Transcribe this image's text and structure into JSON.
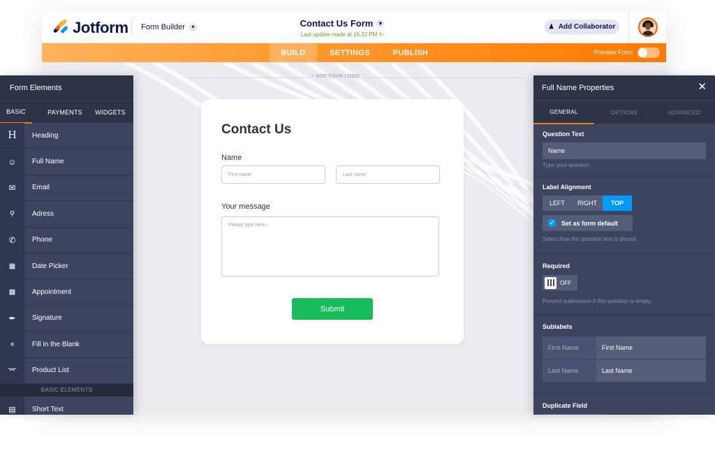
{
  "header": {
    "brand": "Jotform",
    "builder_label": "Form Builder",
    "form_title": "Contact Us Form",
    "last_update": "Last update made at 16:32 PM",
    "add_collaborator": "Add Collaborator"
  },
  "nav": {
    "tabs": [
      {
        "label": "BUILD",
        "active": true
      },
      {
        "label": "SETTINGS",
        "active": false
      },
      {
        "label": "PUBLISH",
        "active": false
      }
    ],
    "preview_label": "Preview Form",
    "preview_on": false
  },
  "canvas": {
    "logo_slot": "+ ADD YOUR LOGO"
  },
  "form": {
    "title": "Contact Us",
    "name_label": "Name",
    "first_placeholder": "First name",
    "last_placeholder": "Last name",
    "message_label": "Your message",
    "message_placeholder": "Please type here...",
    "submit_label": "Submit"
  },
  "left_panel": {
    "title": "Form Elements",
    "tabs": [
      "BASIC",
      "PAYMENTS",
      "WIDGETS"
    ],
    "items": [
      {
        "label": "Heading",
        "icon": "heading-icon"
      },
      {
        "label": "Full Name",
        "icon": "user-icon"
      },
      {
        "label": "Email",
        "icon": "envelope-icon"
      },
      {
        "label": "Adress",
        "icon": "location-pin-icon"
      },
      {
        "label": "Phone",
        "icon": "phone-icon"
      },
      {
        "label": "Date Picker",
        "icon": "calendar-icon"
      },
      {
        "label": "Appointment",
        "icon": "appointment-icon"
      },
      {
        "label": "Signature",
        "icon": "pen-icon"
      },
      {
        "label": "Fill in the Blank",
        "icon": "fill-blank-icon"
      },
      {
        "label": "Product List",
        "icon": "cart-icon"
      }
    ],
    "section_label": "BASIC ELEMENTS",
    "extra_items": [
      {
        "label": "Short Text",
        "icon": "short-text-icon"
      }
    ]
  },
  "right_panel": {
    "title": "Full Name Properties",
    "tabs": [
      "GENERAL",
      "OPTIONS",
      "ADVANCED"
    ],
    "question_text": {
      "title": "Question Text",
      "value": "Name",
      "hint": "Type your question."
    },
    "label_alignment": {
      "title": "Label Alignment",
      "options": [
        "LEFT",
        "RIGHT",
        "TOP"
      ],
      "selected": "TOP",
      "default_label": "Set as form default",
      "hint": "Select how the question text is placed."
    },
    "required": {
      "title": "Required",
      "state": "OFF",
      "hint": "Prevent submission if this question is empty."
    },
    "sublabels": {
      "title": "Sublabels",
      "rows": [
        {
          "key": "First Name",
          "value": "First Name"
        },
        {
          "key": "Last Name",
          "value": "Last Name"
        }
      ]
    },
    "duplicate": {
      "title": "Duplicate Field"
    }
  },
  "colors": {
    "accent_orange": "#ff7a00",
    "submit_green": "#18bd5b",
    "selected_blue": "#0099ff",
    "panel_dark": "#3c4460",
    "brand_navy": "#0a1551"
  }
}
